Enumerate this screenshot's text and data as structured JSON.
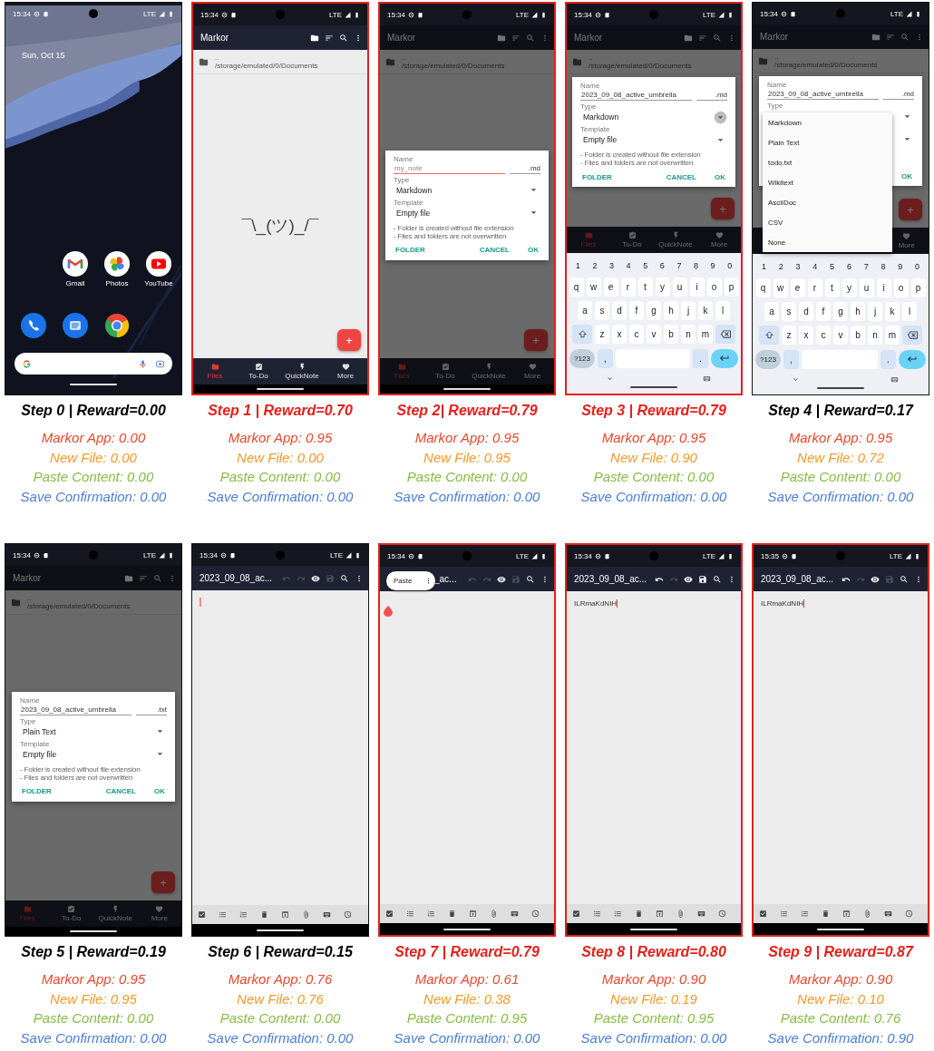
{
  "steps": [
    {
      "highlighted": false,
      "caption": "Step 0 | Reward=0.00",
      "scores": [
        {
          "text": "Markor App: 0.00",
          "color": "#e8472e"
        },
        {
          "text": "New File: 0.00",
          "color": "#f39a2b"
        },
        {
          "text": "Paste Content: 0.00",
          "color": "#86bc45"
        },
        {
          "text": "Save Confirmation: 0.00",
          "color": "#4a7ed6"
        }
      ],
      "screen": {
        "kind": "home",
        "status": {
          "time": "15:34",
          "network": "LTE"
        },
        "date": "Sun, Oct 15",
        "apps": [
          {
            "label": "Gmail"
          },
          {
            "label": "Photos"
          },
          {
            "label": "YouTube"
          }
        ]
      }
    },
    {
      "highlighted": true,
      "caption": "Step 1 | Reward=0.70",
      "scores": [
        {
          "text": "Markor App: 0.95",
          "color": "#e8472e"
        },
        {
          "text": "New File: 0.00",
          "color": "#f39a2b"
        },
        {
          "text": "Paste Content: 0.00",
          "color": "#86bc45"
        },
        {
          "text": "Save Confirmation: 0.00",
          "color": "#4a7ed6"
        }
      ],
      "screen": {
        "kind": "files",
        "status": {
          "time": "15:34",
          "network": "LTE"
        },
        "dimmed": false,
        "app_bar": {
          "title": "Markor"
        },
        "folder_row": {
          "name": "..",
          "path": "/storage/emulated/0/Documents"
        },
        "empty_text": "¯\\_(ツ)_/¯",
        "fab": "+",
        "nav": [
          {
            "label": "Files",
            "selected": true
          },
          {
            "label": "To-Do",
            "selected": false
          },
          {
            "label": "QuickNote",
            "selected": false
          },
          {
            "label": "More",
            "selected": false
          }
        ]
      }
    },
    {
      "highlighted": true,
      "caption": "Step 2| Reward=0.79",
      "scores": [
        {
          "text": "Markor App: 0.95",
          "color": "#e8472e"
        },
        {
          "text": "New File: 0.95",
          "color": "#f39a2b"
        },
        {
          "text": "Paste Content: 0.00",
          "color": "#86bc45"
        },
        {
          "text": "Save Confirmation: 0.00",
          "color": "#4a7ed6"
        }
      ],
      "screen": {
        "kind": "files",
        "status": {
          "time": "15:34",
          "network": "LTE"
        },
        "dimmed": true,
        "app_bar": {
          "title": "Markor"
        },
        "folder_row": {
          "name": "..",
          "path": "/storage/emulated/0/Documents"
        },
        "fab": "+",
        "nav": [
          {
            "label": "Files",
            "selected": true
          },
          {
            "label": "To-Do",
            "selected": false
          },
          {
            "label": "QuickNote",
            "selected": false
          },
          {
            "label": "More",
            "selected": false
          }
        ],
        "dialog": {
          "name_label": "Name",
          "name": "my_note",
          "name_invalid": true,
          "extension": ".md",
          "type_label": "Type",
          "type": "Markdown",
          "type_pressed": false,
          "template_label": "Template",
          "template": "Empty file",
          "notes": [
            "- Folder is created without file extension",
            "- Files and folders are not overwritten"
          ],
          "buttons": [
            {
              "label": "FOLDER",
              "kind": "neutral"
            },
            {
              "label": "CANCEL",
              "kind": "negative"
            },
            {
              "label": "OK",
              "kind": "positive"
            }
          ]
        }
      }
    },
    {
      "highlighted": true,
      "caption": "Step 3 | Reward=0.79",
      "scores": [
        {
          "text": "Markor App: 0.95",
          "color": "#e8472e"
        },
        {
          "text": "New File: 0.90",
          "color": "#f39a2b"
        },
        {
          "text": "Paste Content: 0.00",
          "color": "#86bc45"
        },
        {
          "text": "Save Confirmation: 0.00",
          "color": "#4a7ed6"
        }
      ],
      "screen": {
        "kind": "files",
        "status": {
          "time": "15:34",
          "network": "LTE"
        },
        "dimmed": true,
        "app_bar": {
          "title": "Markor"
        },
        "folder_row": {
          "name": "..",
          "path": "/storage/emulated/0/Documents"
        },
        "fab": "+",
        "nav": [
          {
            "label": "Files",
            "selected": true
          },
          {
            "label": "To-Do",
            "selected": false
          },
          {
            "label": "QuickNote",
            "selected": false
          },
          {
            "label": "More",
            "selected": false
          }
        ],
        "dialog": {
          "name_label": "Name",
          "name": "2023_09_08_active_umbrella",
          "name_invalid": false,
          "extension": ".md",
          "type_label": "Type",
          "type": "Markdown",
          "type_pressed": true,
          "template_label": "Template",
          "template": "Empty file",
          "notes": [
            "- Folder is created without file extension",
            "- Files and folders are not overwritten"
          ],
          "buttons": [
            {
              "label": "FOLDER",
              "kind": "neutral"
            },
            {
              "label": "CANCEL",
              "kind": "negative"
            },
            {
              "label": "OK",
              "kind": "positive"
            }
          ]
        },
        "keyboard": {
          "number_row": [
            "1",
            "2",
            "3",
            "4",
            "5",
            "6",
            "7",
            "8",
            "9",
            "0"
          ],
          "letter_rows": [
            [
              "q",
              "w",
              "e",
              "r",
              "t",
              "y",
              "u",
              "i",
              "o",
              "p"
            ],
            [
              "a",
              "s",
              "d",
              "f",
              "g",
              "h",
              "j",
              "k",
              "l"
            ],
            [
              "z",
              "x",
              "c",
              "v",
              "b",
              "n",
              "m"
            ]
          ],
          "symbols_key": "?123",
          "comma_key": ",",
          "period_key": "."
        }
      }
    },
    {
      "highlighted": false,
      "caption": "Step 4 | Reward=0.17",
      "scores": [
        {
          "text": "Markor App: 0.95",
          "color": "#e8472e"
        },
        {
          "text": "New File: 0.72",
          "color": "#f39a2b"
        },
        {
          "text": "Paste Content: 0.00",
          "color": "#86bc45"
        },
        {
          "text": "Save Confirmation: 0.00",
          "color": "#4a7ed6"
        }
      ],
      "screen": {
        "kind": "files",
        "status": {
          "time": "15:34",
          "network": "LTE"
        },
        "dimmed": true,
        "app_bar": {
          "title": "Markor"
        },
        "folder_row": {
          "name": "..",
          "path": "/storage/emulated/0/Documents"
        },
        "fab": "+",
        "nav": [
          {
            "label": "More",
            "selected": false
          }
        ],
        "dialog": {
          "name_label": "Name",
          "name": "2023_09_08_active_umbrella",
          "name_invalid": false,
          "extension": ".md",
          "type_label": "Type",
          "type_pressed": false,
          "buttons": [
            {
              "label": "OK",
              "kind": "positive"
            }
          ],
          "dropdown": [
            "Markdown",
            "Plain Text",
            "todo.txt",
            "Wikitext",
            "AsciiDoc",
            "CSV",
            "None"
          ]
        },
        "keyboard": {
          "number_row": [
            "1",
            "2",
            "3",
            "4",
            "5",
            "6",
            "7",
            "8",
            "9",
            "0"
          ],
          "letter_rows": [
            [
              "q",
              "w",
              "e",
              "r",
              "t",
              "y",
              "u",
              "i",
              "o",
              "p"
            ],
            [
              "a",
              "s",
              "d",
              "f",
              "g",
              "h",
              "j",
              "k",
              "l"
            ],
            [
              "z",
              "x",
              "c",
              "v",
              "b",
              "n",
              "m"
            ]
          ],
          "symbols_key": "?123",
          "comma_key": ",",
          "period_key": "."
        }
      }
    },
    {
      "highlighted": false,
      "caption": "Step 5 | Reward=0.19",
      "scores": [
        {
          "text": "Markor App: 0.95",
          "color": "#e8472e"
        },
        {
          "text": "New File: 0.95",
          "color": "#f39a2b"
        },
        {
          "text": "Paste Content: 0.00",
          "color": "#86bc45"
        },
        {
          "text": "Save Confirmation: 0.00",
          "color": "#4a7ed6"
        }
      ],
      "screen": {
        "kind": "files",
        "status": {
          "time": "15:34",
          "network": "LTE"
        },
        "dimmed": true,
        "app_bar": {
          "title": "Markor"
        },
        "folder_row": {
          "name": "..",
          "path": "/storage/emulated/0/Documents"
        },
        "fab": "+",
        "nav": [
          {
            "label": "Files",
            "selected": true
          },
          {
            "label": "To-Do",
            "selected": false
          },
          {
            "label": "QuickNote",
            "selected": false
          },
          {
            "label": "More",
            "selected": false
          }
        ],
        "dialog": {
          "name_label": "Name",
          "name": "2023_09_08_active_umbrella",
          "name_invalid": false,
          "extension": ".txt",
          "type_label": "Type",
          "type": "Plain Text",
          "type_pressed": false,
          "template_label": "Template",
          "template": "Empty file",
          "notes": [
            "- Folder is created without file extension",
            "- Files and folders are not overwritten"
          ],
          "buttons": [
            {
              "label": "FOLDER",
              "kind": "neutral"
            },
            {
              "label": "CANCEL",
              "kind": "negative"
            },
            {
              "label": "OK",
              "kind": "positive"
            }
          ]
        }
      }
    },
    {
      "highlighted": false,
      "caption": "Step 6 | Reward=0.15",
      "scores": [
        {
          "text": "Markor App: 0.76",
          "color": "#e8472e"
        },
        {
          "text": "New File: 0.76",
          "color": "#f39a2b"
        },
        {
          "text": "Paste Content: 0.00",
          "color": "#86bc45"
        },
        {
          "text": "Save Confirmation: 0.00",
          "color": "#4a7ed6"
        }
      ],
      "screen": {
        "kind": "editor",
        "status": {
          "time": "15:34",
          "network": "LTE"
        },
        "app_bar": {
          "title": "2023_09_08_ac...",
          "undo_enabled": false,
          "save_enabled": false
        },
        "cursor": true
      }
    },
    {
      "highlighted": true,
      "caption": "Step 7 | Reward=0.79",
      "scores": [
        {
          "text": "Markor App: 0.61",
          "color": "#e8472e"
        },
        {
          "text": "New File: 0.38",
          "color": "#f39a2b"
        },
        {
          "text": "Paste Content: 0.95",
          "color": "#86bc45"
        },
        {
          "text": "Save Confirmation: 0.00",
          "color": "#4a7ed6"
        }
      ],
      "screen": {
        "kind": "editor",
        "status": {
          "time": "15:34",
          "network": "LTE"
        },
        "app_bar": {
          "title": "_ac...",
          "undo_enabled": false,
          "save_enabled": false
        },
        "paste_menu": {
          "label": "Paste"
        },
        "selection_handle": true
      }
    },
    {
      "highlighted": true,
      "caption": "Step 8 | Reward=0.80",
      "scores": [
        {
          "text": "Markor App: 0.90",
          "color": "#e8472e"
        },
        {
          "text": "New File: 0.19",
          "color": "#f39a2b"
        },
        {
          "text": "Paste Content: 0.95",
          "color": "#86bc45"
        },
        {
          "text": "Save Confirmation: 0.00",
          "color": "#4a7ed6"
        }
      ],
      "screen": {
        "kind": "editor",
        "status": {
          "time": "15:34",
          "network": "LTE"
        },
        "app_bar": {
          "title": "2023_09_08_ac...",
          "undo_enabled": true,
          "save_enabled": true
        },
        "text": "ILRmaKdNIH",
        "cursor": true
      }
    },
    {
      "highlighted": true,
      "caption": "Step 9 | Reward=0.87",
      "scores": [
        {
          "text": "Markor App: 0.90",
          "color": "#e8472e"
        },
        {
          "text": "New File: 0.10",
          "color": "#f39a2b"
        },
        {
          "text": "Paste Content: 0.76",
          "color": "#86bc45"
        },
        {
          "text": "Save Confirmation: 0.90",
          "color": "#4a7ed6"
        }
      ],
      "screen": {
        "kind": "editor",
        "status": {
          "time": "15:35",
          "network": "LTE"
        },
        "app_bar": {
          "title": "2023_09_08_ac...",
          "undo_enabled": true,
          "save_enabled": false
        },
        "text": "ILRmaKdNIH",
        "cursor": true
      }
    }
  ]
}
